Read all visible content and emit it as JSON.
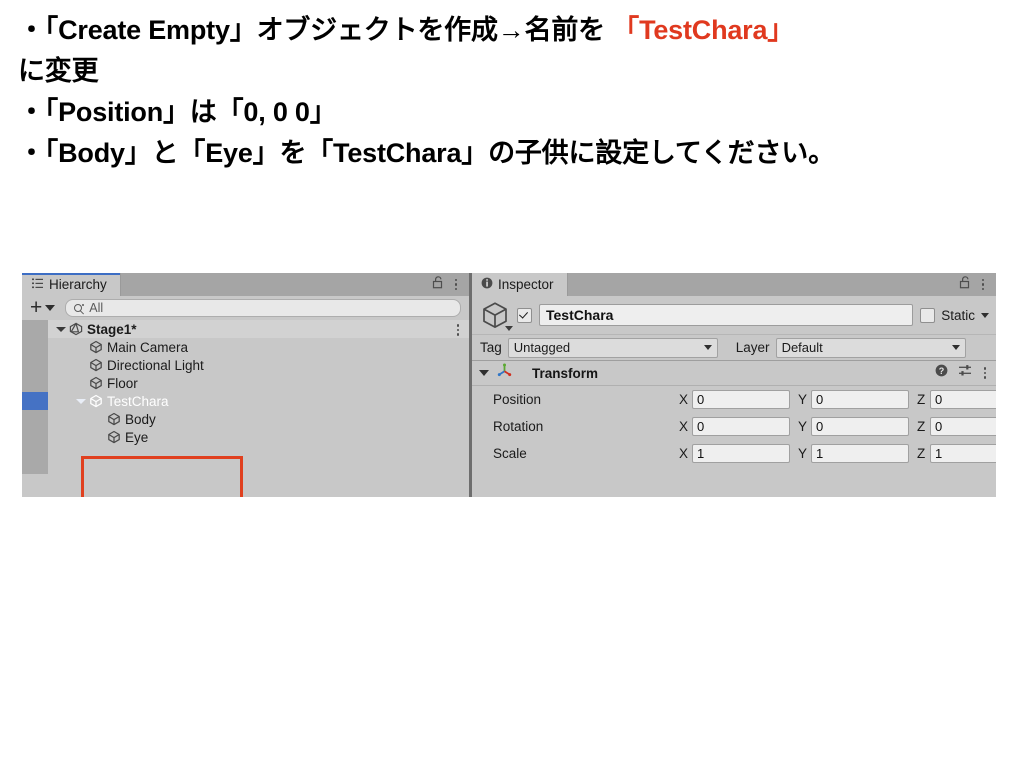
{
  "instructions": {
    "lines": [
      {
        "segments": [
          {
            "text": "・「Create Empty」オブジェクトを作成→名前を ",
            "accent": false
          },
          {
            "text": "「TestChara」",
            "accent": true
          }
        ]
      },
      {
        "segments": [
          {
            "text": "に変更",
            "accent": false
          }
        ]
      },
      {
        "segments": [
          {
            "text": "・「Position」は「0, 0 0」",
            "accent": false
          }
        ]
      },
      {
        "segments": [
          {
            "text": "・「Body」と「Eye」を「TestChara」の子供に設定してください。",
            "accent": false
          }
        ]
      }
    ],
    "accent_color": "#e0391f"
  },
  "hierarchy": {
    "tab_label": "Hierarchy",
    "tab_icon": "hierarchy-list-icon",
    "focused": true,
    "lock_icon": "padlock-unlocked-icon",
    "menu_icon": "kebab-menu-icon",
    "toolbar": {
      "create_label": "+",
      "create_caret_icon": "chevron-down-icon",
      "search_icon": "search-icon",
      "search_value": "All"
    },
    "tree": [
      {
        "label": "Stage1*",
        "depth": 0,
        "icon": "unity-scene-icon",
        "expanded": true,
        "selected": false,
        "is_scene": true,
        "has_row_menu": true
      },
      {
        "label": "Main Camera",
        "depth": 1,
        "icon": "gameobject-cube-icon",
        "expanded": null,
        "selected": false,
        "is_scene": false,
        "has_row_menu": false
      },
      {
        "label": "Directional Light",
        "depth": 1,
        "icon": "gameobject-cube-icon",
        "expanded": null,
        "selected": false,
        "is_scene": false,
        "has_row_menu": false
      },
      {
        "label": "Floor",
        "depth": 1,
        "icon": "gameobject-cube-icon",
        "expanded": null,
        "selected": false,
        "is_scene": false,
        "has_row_menu": false
      },
      {
        "label": "TestChara",
        "depth": 1,
        "icon": "gameobject-cube-icon",
        "expanded": true,
        "selected": true,
        "is_scene": false,
        "has_row_menu": false
      },
      {
        "label": "Body",
        "depth": 2,
        "icon": "gameobject-cube-icon",
        "expanded": null,
        "selected": false,
        "is_scene": false,
        "has_row_menu": false
      },
      {
        "label": "Eye",
        "depth": 2,
        "icon": "gameobject-cube-icon",
        "expanded": null,
        "selected": false,
        "is_scene": false,
        "has_row_menu": false
      }
    ],
    "selection_color": "#4572c4",
    "annotation_box_color": "#e0401f"
  },
  "inspector": {
    "tab_label": "Inspector",
    "tab_icon": "info-circle-icon",
    "focused": false,
    "lock_icon": "padlock-unlocked-icon",
    "menu_icon": "kebab-menu-icon",
    "object": {
      "icon": "gameobject-cube-icon",
      "enabled": true,
      "name": "TestChara",
      "static_label": "Static",
      "static_checked": false,
      "static_caret_icon": "chevron-down-icon",
      "tag_label": "Tag",
      "tag_value": "Untagged",
      "layer_label": "Layer",
      "layer_value": "Default"
    },
    "component": {
      "title": "Transform",
      "icon": "transform-gizmo-icon",
      "expanded": true,
      "help_icon": "help-circle-icon",
      "preset_icon": "preset-sliders-icon",
      "menu_icon": "kebab-menu-icon",
      "rows": [
        {
          "label": "Position",
          "x": "0",
          "y": "0",
          "z": "0"
        },
        {
          "label": "Rotation",
          "x": "0",
          "y": "0",
          "z": "0"
        },
        {
          "label": "Scale",
          "x": "1",
          "y": "1",
          "z": "1"
        }
      ],
      "axis_labels": [
        "X",
        "Y",
        "Z"
      ]
    }
  }
}
